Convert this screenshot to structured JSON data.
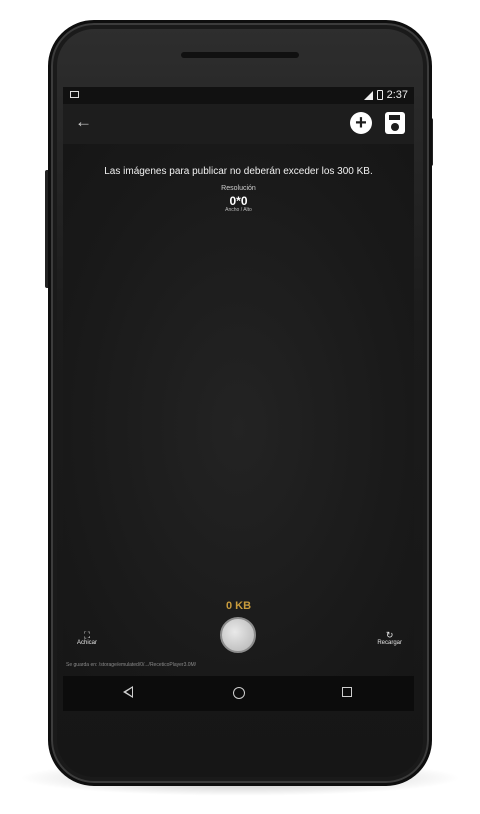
{
  "status_bar": {
    "time": "2:37"
  },
  "toolbar": {
    "back_icon": "arrow-left-icon",
    "add_icon": "plus-circle-icon",
    "save_icon": "save-icon"
  },
  "notice": "Las imágenes para publicar no deberán exceder los 300 KB.",
  "resolution": {
    "label": "Resolución",
    "value": "0*0",
    "sub_label": "Ancho / Alto"
  },
  "size_label": "0 KB",
  "actions": {
    "left_label": "Achicar",
    "right_label": "Recargar"
  },
  "save_path": "Se guarda en: /storage/emulated/0/.../ReceticoPlayer3.0M/",
  "colors": {
    "accent": "#c89b3c",
    "background": "#161616"
  }
}
